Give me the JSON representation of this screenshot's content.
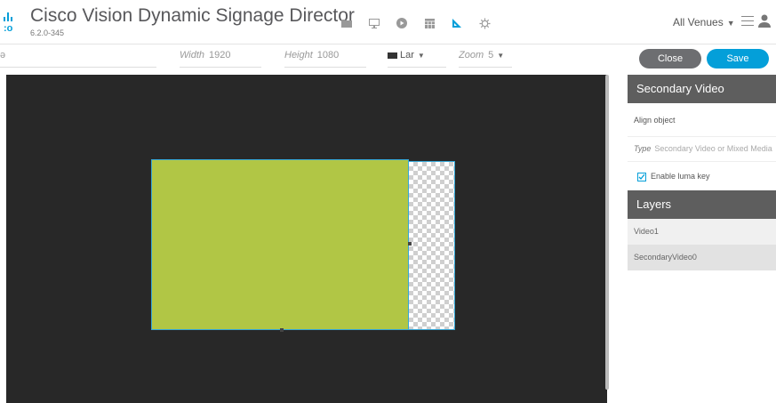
{
  "header": {
    "logo_text": ":o",
    "title": "Cisco Vision Dynamic Signage Director",
    "version": "6.2.0-345",
    "nav_icons": [
      "folder-icon",
      "monitor-icon",
      "play-icon",
      "calendar-icon",
      "design-icon",
      "gear-icon"
    ],
    "venues_label": "All Venues"
  },
  "toolbar": {
    "name_value": "ə",
    "width_label": "Width",
    "width_value": "1920",
    "height_label": "Height",
    "height_value": "1080",
    "layer_value": "Lar",
    "zoom_label": "Zoom",
    "zoom_value": "5",
    "close_label": "Close",
    "save_label": "Save"
  },
  "panel": {
    "secondary_title": "Secondary Video",
    "align_label": "Align object",
    "type_label": "Type",
    "type_value": "Secondary Video or Mixed Media",
    "luma_label": "Enable luma key",
    "luma_checked": true,
    "layers_title": "Layers",
    "layers": [
      "Video1",
      "SecondaryVideo0"
    ]
  },
  "colors": {
    "accent": "#049fd9",
    "video_region": "#b1c645",
    "canvas_bg": "#282828"
  }
}
